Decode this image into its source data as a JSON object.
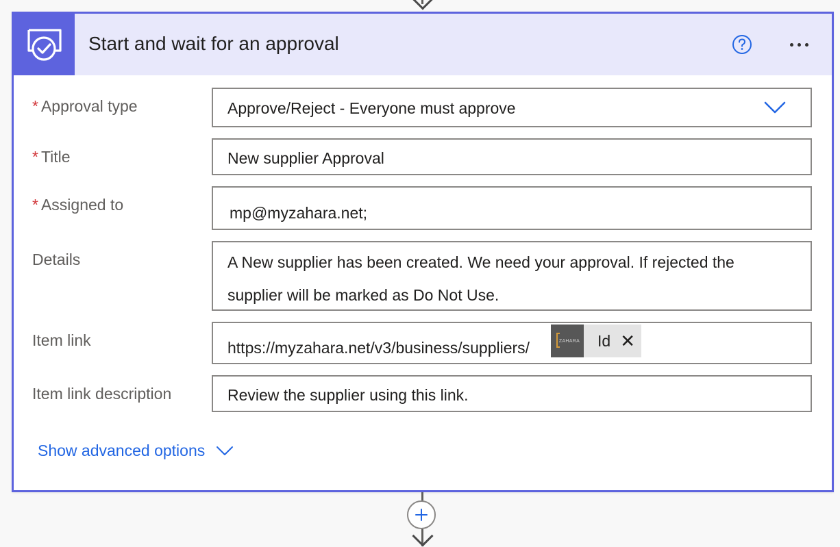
{
  "header": {
    "title": "Start and wait for an approval",
    "icon": "approval-icon",
    "help_icon": "help-icon",
    "more_icon": "more-options-icon",
    "accent_color": "#5d63de",
    "header_bg": "#e8e8fb"
  },
  "fields": {
    "approval_type": {
      "label": "Approval type",
      "required": "*",
      "value": "Approve/Reject - Everyone must approve"
    },
    "title": {
      "label": "Title",
      "required": "*",
      "value": "New supplier Approval"
    },
    "assigned_to": {
      "label": "Assigned to",
      "required": "*",
      "value": "mp@myzahara.net;"
    },
    "details": {
      "label": "Details",
      "value": "A New supplier has been created. We need your approval. If rejected the supplier will be marked as Do Not Use."
    },
    "item_link": {
      "label": "Item link",
      "value": "https://myzahara.net/v3/business/suppliers/",
      "token": {
        "label": "Id",
        "logo_text": "ZAHARA"
      }
    },
    "item_link_description": {
      "label": "Item link description",
      "value": "Review the supplier using this link."
    }
  },
  "advanced": {
    "label": "Show advanced options",
    "link_color": "#2266e3"
  },
  "colors": {
    "required": "#d13438",
    "border": "#8a8886"
  }
}
